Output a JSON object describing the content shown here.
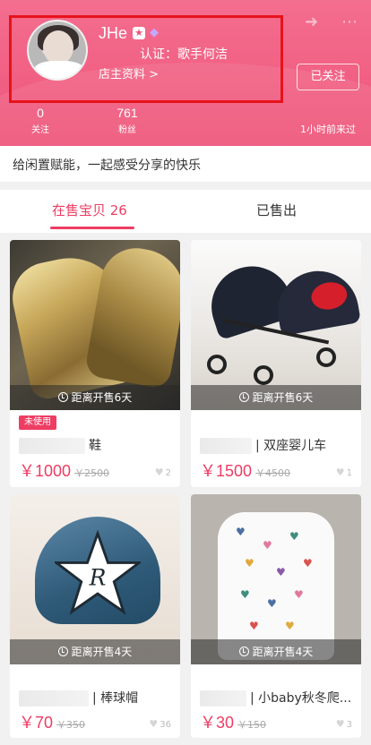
{
  "header": {
    "shop_name": "JHe",
    "verification": "认证：歌手何洁",
    "shop_info_link": "店主资料 >",
    "follow_button": "已关注",
    "last_seen": "1小时前来过",
    "star_badge": "★",
    "gem_badge": "◆",
    "share_icon_glyph": "➜",
    "more_icon_glyph": "⋯",
    "stats": [
      {
        "value": "0",
        "label": "关注"
      },
      {
        "value": "761",
        "label": "粉丝"
      }
    ]
  },
  "slogan": "给闲置赋能，一起感受分享的快乐",
  "tabs": {
    "on_sale": "在售宝贝 26",
    "sold": "已售出"
  },
  "products": [
    {
      "photo": "gold-sneakers",
      "countdown": "距离开售6天",
      "tag": "未使用",
      "title": "鞋",
      "price": "￥1000",
      "original_price": "￥2500",
      "likes": "2"
    },
    {
      "photo": "twin-stroller",
      "countdown": "距离开售6天",
      "title": "| 双座婴儿车",
      "price": "￥1500",
      "original_price": "￥4500",
      "likes": "1"
    },
    {
      "photo": "denim-cap",
      "countdown": "距离开售4天",
      "title": "| 棒球帽",
      "price": "￥70",
      "original_price": "￥350",
      "likes": "36"
    },
    {
      "photo": "baby-onesie",
      "countdown": "距离开售4天",
      "title": "| 小baby秋冬爬...",
      "price": "￥30",
      "original_price": "￥150",
      "likes": "3"
    }
  ],
  "colors": {
    "header_pink": "#ee5479",
    "accent_red": "#ee3d63",
    "highlight_box": "#e8121b"
  }
}
